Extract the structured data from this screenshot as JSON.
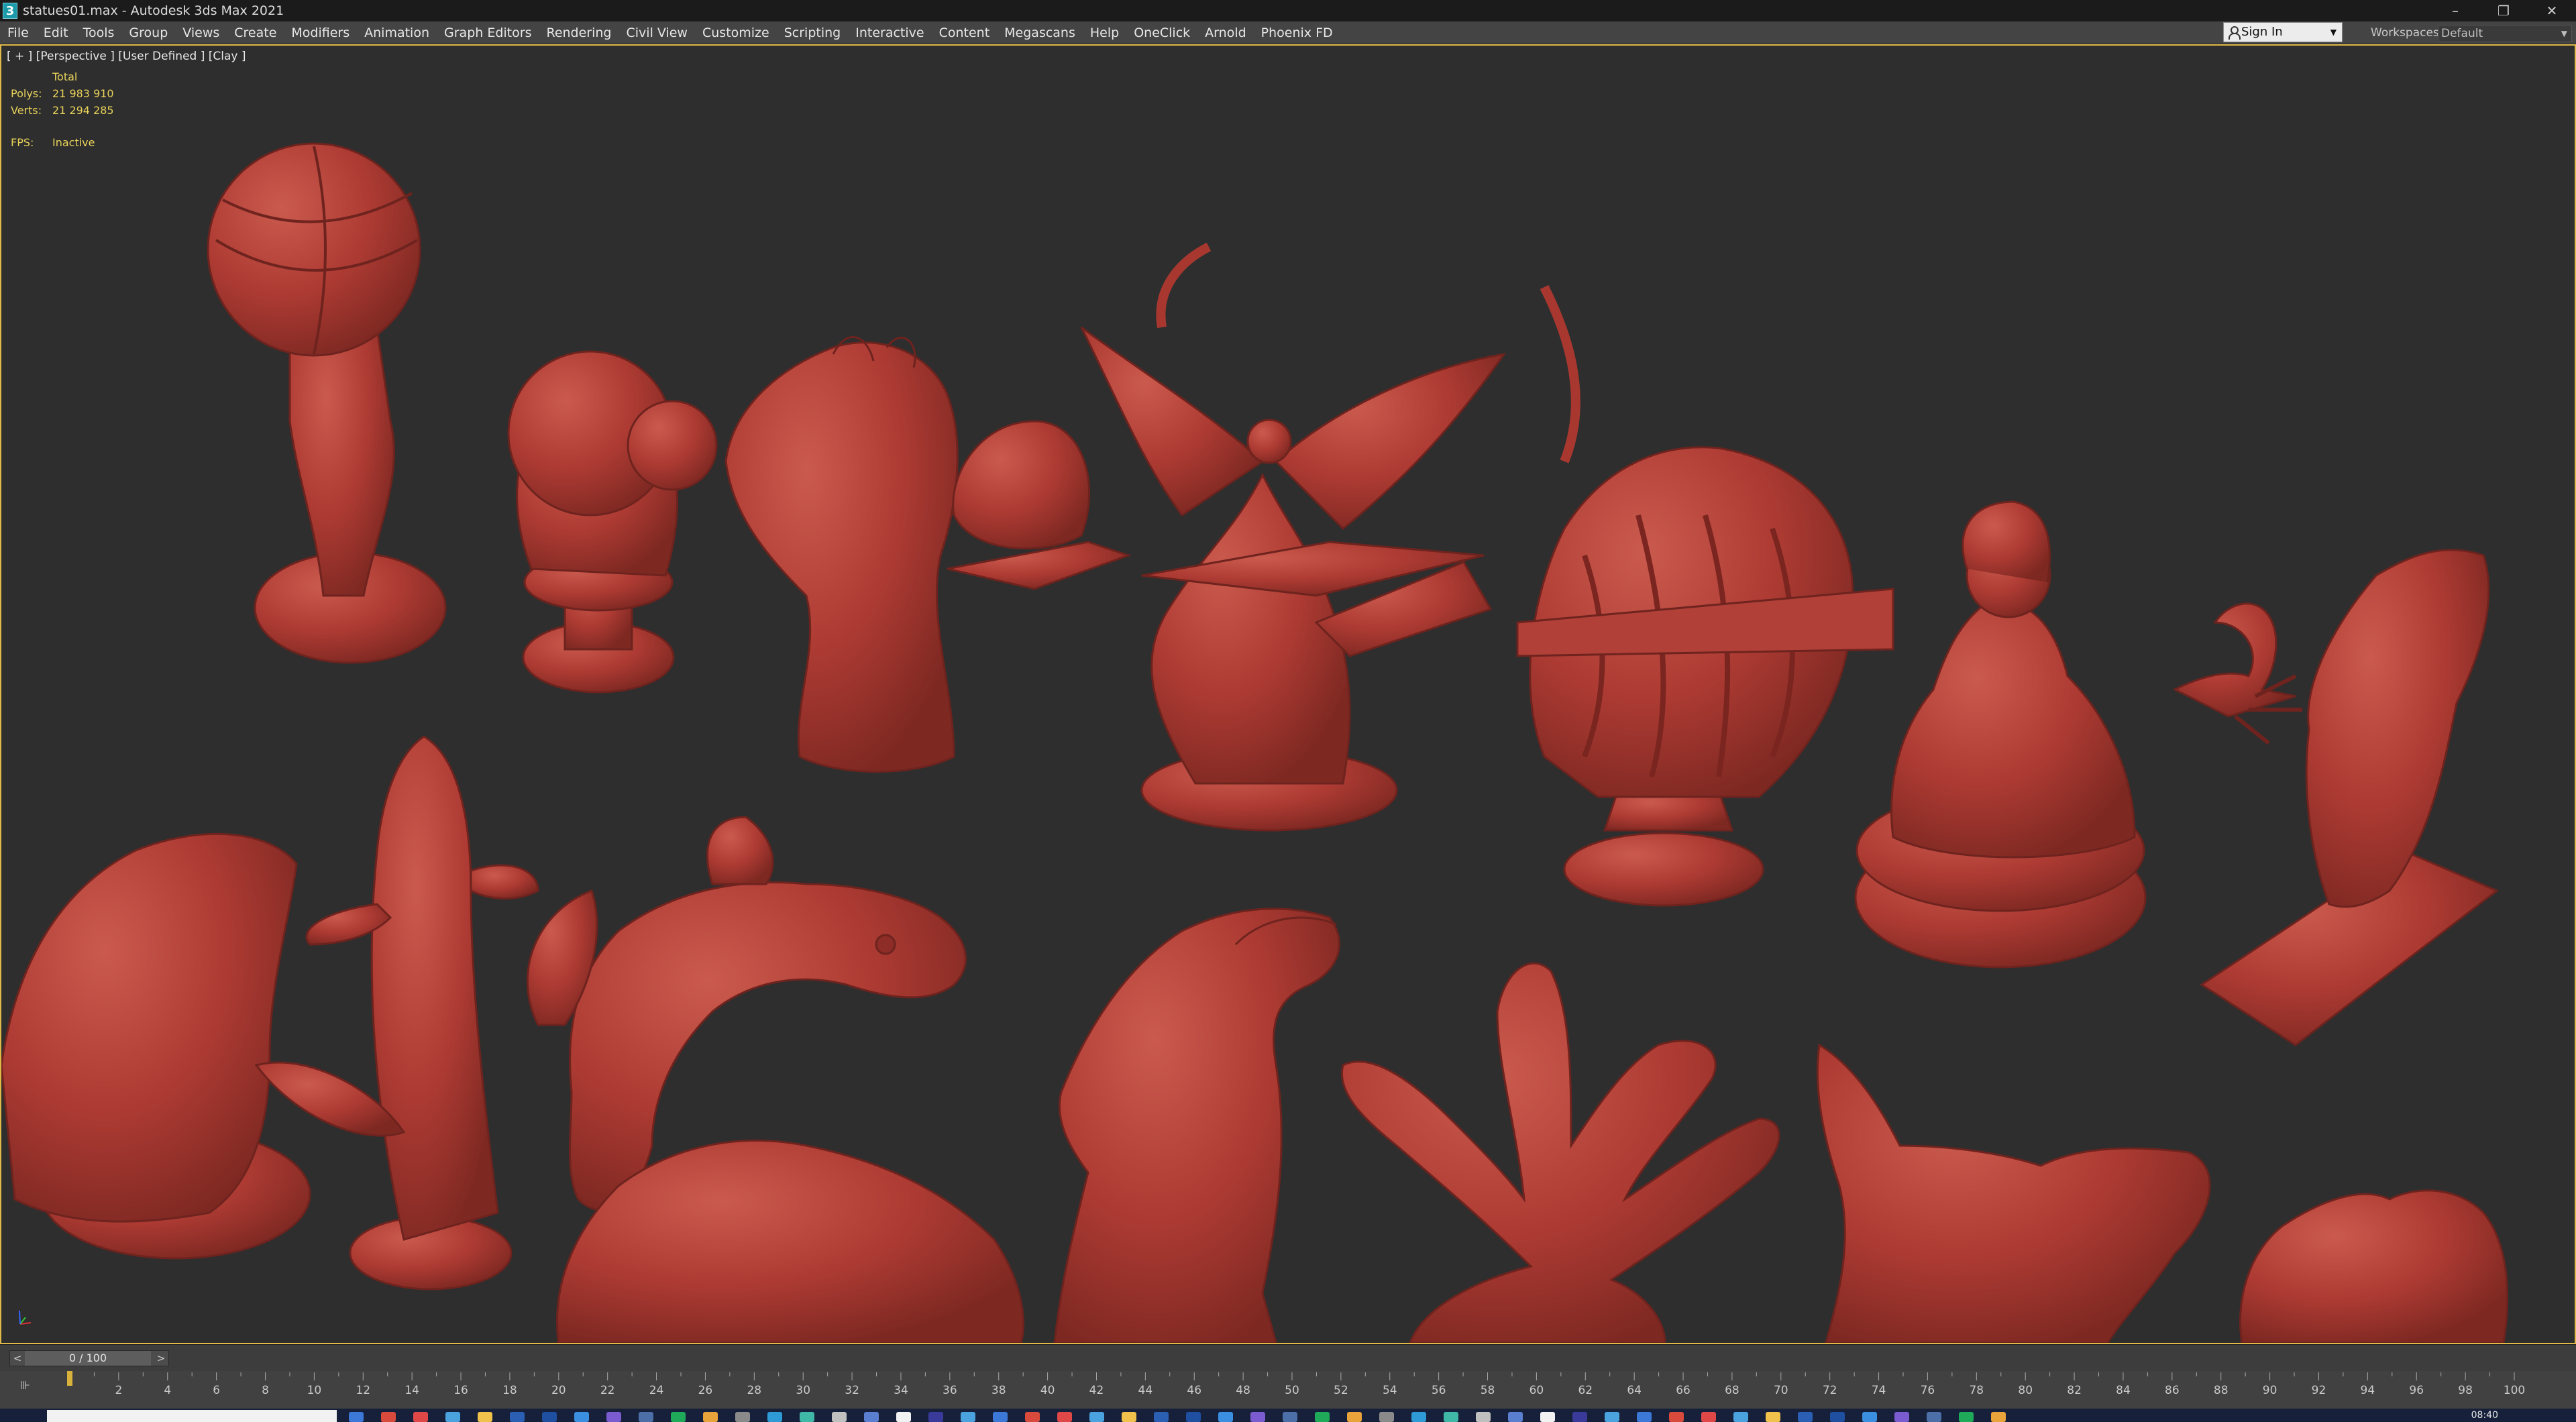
{
  "titlebar": {
    "app_icon": "3",
    "title": "statues01.max - Autodesk 3ds Max 2021",
    "minimize_icon": "–",
    "restore_icon": "❐",
    "close_icon": "✕"
  },
  "menu": {
    "items": [
      "File",
      "Edit",
      "Tools",
      "Group",
      "Views",
      "Create",
      "Modifiers",
      "Animation",
      "Graph Editors",
      "Rendering",
      "Civil View",
      "Customize",
      "Scripting",
      "Interactive",
      "Content",
      "Megascans",
      "Help",
      "OneClick",
      "Arnold",
      "Phoenix FD"
    ]
  },
  "signin": {
    "label": "Sign In",
    "caret": "▼"
  },
  "workspaces": {
    "label": "Workspaces:",
    "value": "Default",
    "caret": "▼"
  },
  "viewport": {
    "label": "[ + ] [Perspective ] [User Defined ] [Clay ]",
    "stats": {
      "total_label": "Total",
      "polys_label": "Polys:",
      "polys_value": "21 983 910",
      "verts_label": "Verts:",
      "verts_value": "21 294 285",
      "fps_label": "FPS:",
      "fps_value": "Inactive"
    },
    "clay_color": "#b13e35",
    "clay_shade": "#8e2d27",
    "clay_highlight": "#cb5a4e",
    "frame_color": "#e1b948"
  },
  "timeline": {
    "slider_text": "0 / 100",
    "prev_icon": "<",
    "next_icon": ">",
    "toggle_label": "⊪",
    "ticks": [
      "2",
      "4",
      "6",
      "8",
      "10",
      "12",
      "14",
      "16",
      "18",
      "20",
      "22",
      "24",
      "26",
      "28",
      "30",
      "32",
      "34",
      "36",
      "38",
      "40",
      "42",
      "44",
      "46",
      "48",
      "50",
      "52",
      "54",
      "56",
      "58",
      "60",
      "62",
      "64",
      "66",
      "68",
      "70",
      "72",
      "74",
      "76",
      "78",
      "80",
      "82",
      "84",
      "86",
      "88",
      "90",
      "92",
      "94",
      "96",
      "98",
      "100"
    ]
  },
  "taskbar": {
    "clock": "08:40"
  }
}
